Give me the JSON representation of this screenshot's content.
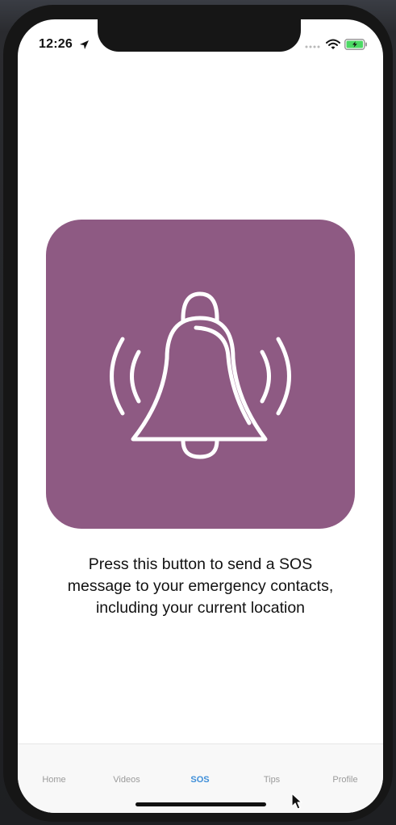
{
  "status_bar": {
    "time": "12:26"
  },
  "sos": {
    "description_lines": [
      "Press this button to send a SOS",
      "message to your emergency contacts,",
      "including your current location"
    ],
    "button_color": "#8e5a83"
  },
  "tabs": [
    {
      "label": "Home"
    },
    {
      "label": "Videos"
    },
    {
      "label": "SOS",
      "active": true
    },
    {
      "label": "Tips"
    },
    {
      "label": "Profile"
    }
  ],
  "colors": {
    "active_tab": "#3f8fd9",
    "inactive_tab": "#9b9b9b"
  },
  "icons": [
    "location-arrow-icon",
    "signal-icon",
    "wifi-icon",
    "battery-icon",
    "bell-icon",
    "cursor-icon"
  ]
}
